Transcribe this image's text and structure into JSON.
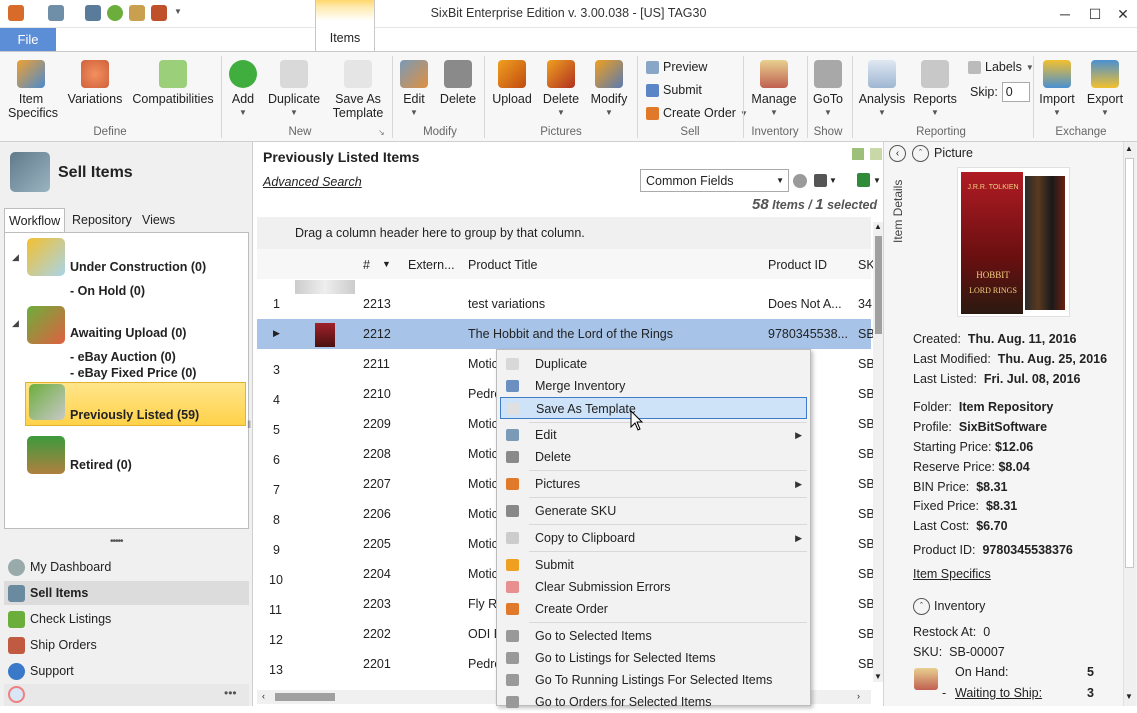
{
  "window": {
    "title": "SixBit Enterprise Edition v. 3.00.038 - [US] TAG30"
  },
  "tabs": {
    "file": "File",
    "items": "Items"
  },
  "ribbon": {
    "item_specifics": "Item\nSpecifics",
    "variations": "Variations",
    "compatibilities": "Compatibilities",
    "group_define": "Define",
    "add": "Add",
    "duplicate": "Duplicate",
    "save_as_template": "Save As\nTemplate",
    "group_new": "New",
    "edit": "Edit",
    "delete": "Delete",
    "group_modify": "Modify",
    "upload": "Upload",
    "pic_delete": "Delete",
    "pic_modify": "Modify",
    "group_pictures": "Pictures",
    "preview": "Preview",
    "submit": "Submit",
    "create_order": "Create Order",
    "group_sell": "Sell",
    "manage": "Manage",
    "group_inventory": "Inventory",
    "goto": "GoTo",
    "group_show": "Show",
    "analysis": "Analysis",
    "reports": "Reports",
    "labels": "Labels",
    "skip_label": "Skip:",
    "skip_value": "0",
    "group_reporting": "Reporting",
    "import": "Import",
    "export": "Export",
    "group_exchange": "Exchange"
  },
  "left": {
    "header": "Sell Items",
    "tabs": [
      "Workflow",
      "Repository",
      "Views"
    ],
    "workflow": {
      "under_construction": "Under Construction  (0)",
      "on_hold": "- On Hold  (0)",
      "awaiting_upload": "Awaiting Upload  (0)",
      "ebay_auction": "- eBay Auction  (0)",
      "ebay_fixed": "- eBay Fixed Price  (0)",
      "previously_listed": "Previously Listed  (59)",
      "retired": "Retired  (0)"
    },
    "grip": "•••••",
    "nav": [
      "My Dashboard",
      "Sell Items",
      "Check Listings",
      "Ship Orders",
      "Support"
    ],
    "more": "•••"
  },
  "center": {
    "title": "Previously Listed Items",
    "advanced_search": "Advanced Search",
    "fields_select": "Common Fields",
    "count_items": "58",
    "items_label": "Items /",
    "count_selected": "1",
    "selected_label": "selected",
    "group_hint": "Drag a column header here to group by that column.",
    "columns": [
      "#",
      "Extern...",
      "Product Title",
      "Product ID",
      "SK"
    ],
    "rows": [
      {
        "n": "1",
        "id": "2213",
        "title": "test variations",
        "pid": "Does Not A...",
        "sku": "34"
      },
      {
        "n": "",
        "id": "2212",
        "title": "The Hobbit and the Lord of the Rings",
        "pid": "9780345538...",
        "sku": "SB"
      },
      {
        "n": "3",
        "id": "2211",
        "title": "Motic",
        "pid": "",
        "sku": "SB"
      },
      {
        "n": "4",
        "id": "2210",
        "title": "Pedro",
        "pid": "",
        "sku": "SB"
      },
      {
        "n": "5",
        "id": "2209",
        "title": "Motic",
        "pid": "",
        "sku": "SB"
      },
      {
        "n": "6",
        "id": "2208",
        "title": "Motic",
        "pid": "",
        "sku": "SB"
      },
      {
        "n": "7",
        "id": "2207",
        "title": "Motic",
        "pid": "",
        "sku": "SB"
      },
      {
        "n": "8",
        "id": "2206",
        "title": "Motic",
        "pid": "",
        "sku": "SB"
      },
      {
        "n": "9",
        "id": "2205",
        "title": "Motic",
        "pid": "",
        "sku": "SB"
      },
      {
        "n": "10",
        "id": "2204",
        "title": "Motic",
        "pid": "",
        "sku": "SB"
      },
      {
        "n": "11",
        "id": "2203",
        "title": "Fly Ra",
        "pid": "",
        "sku": "SB"
      },
      {
        "n": "12",
        "id": "2202",
        "title": "ODI E",
        "pid": "",
        "sku": "SB"
      },
      {
        "n": "13",
        "id": "2201",
        "title": "Pedro",
        "pid": "",
        "sku": "SB"
      }
    ]
  },
  "context_menu": {
    "items": [
      "Duplicate",
      "Merge Inventory",
      "Save As Template",
      "Edit",
      "Delete",
      "Pictures",
      "Generate SKU",
      "Copy to Clipboard",
      "Submit",
      "Clear Submission Errors",
      "Create Order",
      "Go to Selected Items",
      "Go to Listings for Selected Items",
      "Go To Running Listings For Selected Items",
      "Go to Orders for Selected Items"
    ]
  },
  "details": {
    "side_tab": "Item Details",
    "picture_label": "Picture",
    "book_line1": "J.R.R. TOLKIEN",
    "book_line2": "HOBBIT",
    "book_line3": "LORD RINGS",
    "created_label": "Created:",
    "created": "Thu. Aug. 11, 2016",
    "modified_label": "Last Modified:",
    "modified": "Thu. Aug. 25, 2016",
    "listed_label": "Last Listed:",
    "listed": "Fri. Jul. 08, 2016",
    "folder_label": "Folder:",
    "folder": "Item Repository",
    "profile_label": "Profile:",
    "profile": "SixBitSoftware",
    "start_label": "Starting Price:",
    "start": "$12.06",
    "reserve_label": "Reserve Price:",
    "reserve": "$8.04",
    "bin_label": "BIN Price:",
    "bin": "$8.31",
    "fixed_label": "Fixed Price:",
    "fixed": "$8.31",
    "cost_label": "Last Cost:",
    "cost": "$6.70",
    "pid_label": "Product ID:",
    "pid": "9780345538376",
    "item_specifics": "Item Specifics",
    "inventory": "Inventory",
    "restock_label": "Restock At:",
    "restock": "0",
    "sku_label": "SKU:",
    "sku": "SB-00007",
    "onhand_label": "On Hand:",
    "onhand": "5",
    "waiting_label": "Waiting to Ship:",
    "waiting": "3"
  }
}
